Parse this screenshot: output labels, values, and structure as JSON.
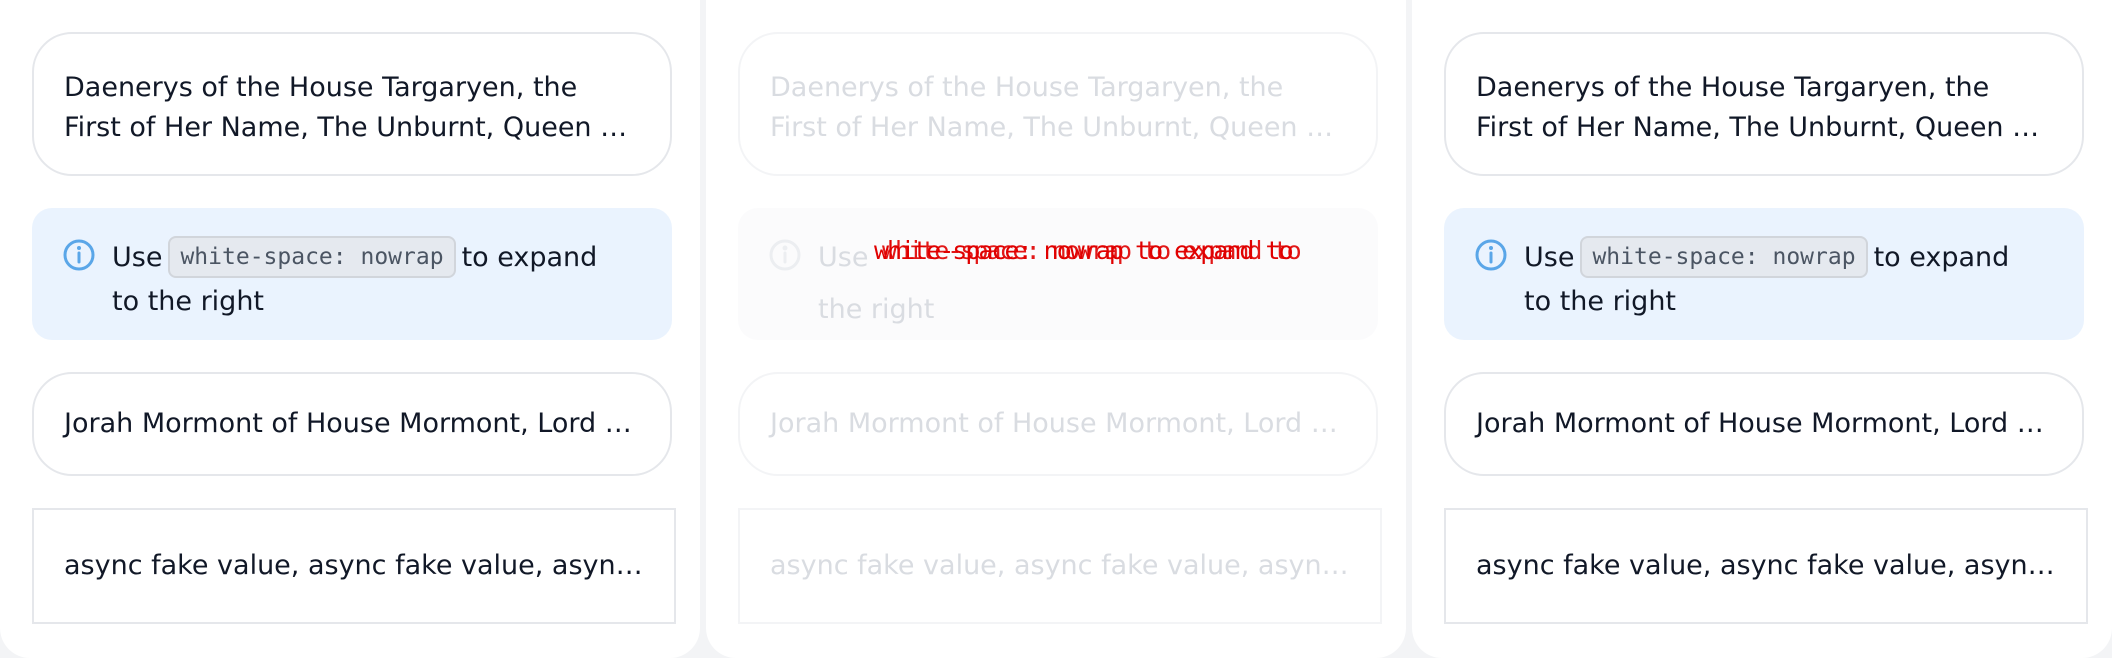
{
  "cards": {
    "title_text": "Daenerys of the House Targaryen, the First of Her Name, The Unburnt, Queen of the Andals and the First Men",
    "alert_prefix": "Use",
    "alert_code": "white-space: nowrap",
    "alert_suffix": "to expand to the right",
    "row_text": "Jorah Mormont of House Mormont, Lord of Bear Island",
    "list_text": "async fake value, async fake value, async fake value"
  },
  "overlay": {
    "red_text": "white-space: nowrap to expand to"
  },
  "colors": {
    "alert_bg": "#eaf3fe",
    "info_icon": "#5aa6e8",
    "overlay_red": "#e00000"
  },
  "icons": {
    "alert_icon": "info-circle-icon"
  }
}
